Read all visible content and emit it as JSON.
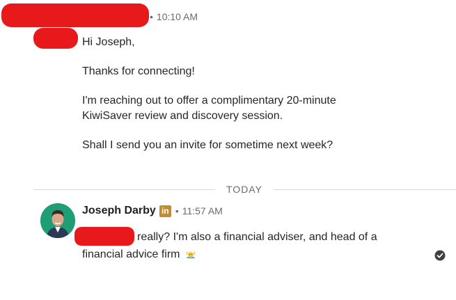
{
  "first_message": {
    "timestamp": "10:10 AM",
    "paragraphs": [
      "Hi Joseph,",
      "Thanks for connecting!",
      "I'm reaching out to offer a complimentary 20-minute KiwiSaver review and discovery session.",
      "Shall I send you an invite for sometime next week?"
    ]
  },
  "divider": {
    "label": "TODAY"
  },
  "second_message": {
    "sender_name": "Joseph Darby",
    "badge_text": "in",
    "timestamp": "11:57 AM",
    "line1": "really? I'm also a financial adviser, and head of a",
    "line2": "financial advice firm",
    "emoji": "person-raising-hands-icon"
  },
  "colors": {
    "redaction": "#e8191a",
    "avatar_bg": "#1f9d75",
    "badge_bg": "#c28b2c",
    "divider": "#d9d9d9"
  }
}
